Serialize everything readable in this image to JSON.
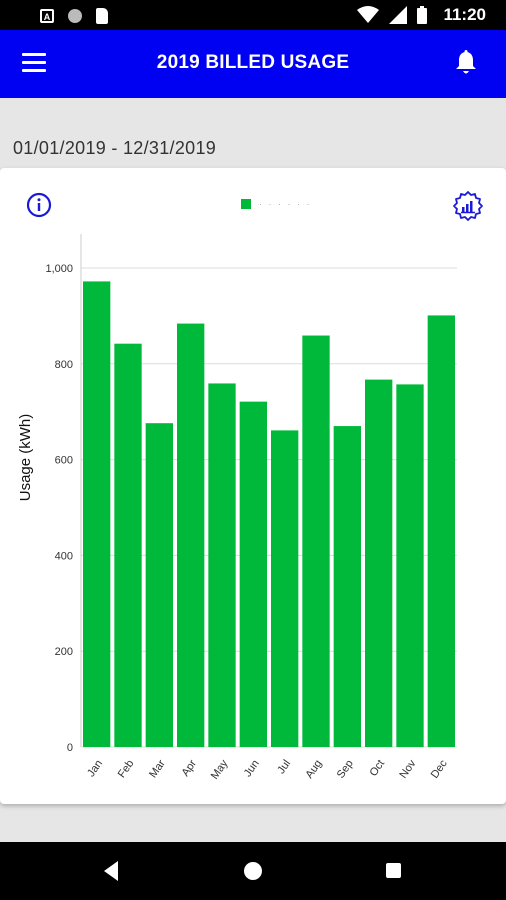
{
  "status_bar": {
    "time": "11:20",
    "left_icons": [
      "a-notification-icon",
      "circle-notification-icon",
      "sim-card-icon"
    ],
    "right_icons": [
      "wifi-icon",
      "cellular-icon",
      "battery-icon"
    ]
  },
  "app_bar": {
    "title": "2019 BILLED USAGE",
    "left_icon": "menu-icon",
    "right_icon": "bell-icon",
    "background_color": "#0000f2"
  },
  "date_range": "01/01/2019 - 12/31/2019",
  "card": {
    "left_icon": "info-icon",
    "right_icon": "settings-icon",
    "legend_label": "· · · · · ·"
  },
  "chart_data": {
    "type": "bar",
    "categories": [
      "Jan",
      "Feb",
      "Mar",
      "Apr",
      "May",
      "Jun",
      "Jul",
      "Aug",
      "Sep",
      "Oct",
      "Nov",
      "Dec"
    ],
    "series": [
      {
        "values": [
          972,
          842,
          676,
          884,
          759,
          721,
          661,
          859,
          670,
          767,
          757,
          901
        ],
        "color": "#00b93a"
      }
    ],
    "title": "",
    "xlabel": "",
    "ylabel": "Usage (kWh)",
    "ylim": [
      0,
      1000
    ],
    "yticks": [
      0,
      200,
      400,
      600,
      800,
      1000
    ],
    "ytick_labels": [
      "0",
      "200",
      "400",
      "600",
      "800",
      "1,000"
    ],
    "grid": true,
    "legend": "top-center"
  },
  "nav_bar": {
    "icons": [
      "back-icon",
      "home-icon",
      "recent-apps-icon"
    ]
  }
}
